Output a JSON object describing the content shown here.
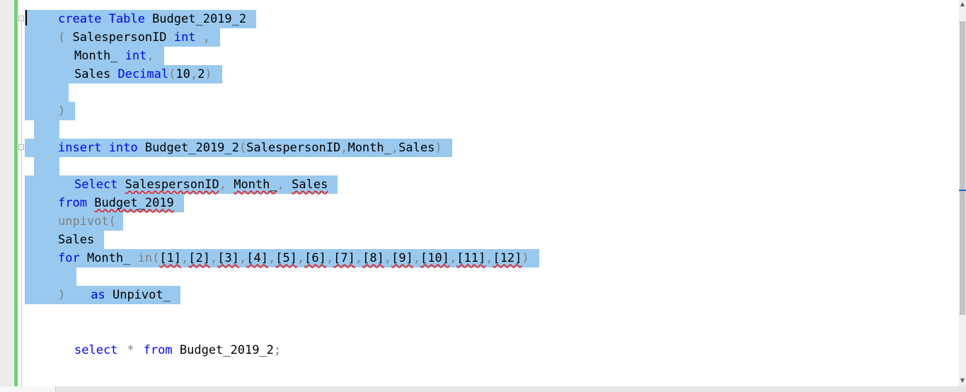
{
  "editor": {
    "lines": {
      "l1": {
        "a": "create Table",
        "b": " Budget_2019_2"
      },
      "l2": {
        "a": "( ",
        "b": "SalespersonID ",
        "c": "int",
        "d": " ,"
      },
      "l3": {
        "a": "Month_ ",
        "b": "int",
        "c": ","
      },
      "l4": {
        "a": "Sales ",
        "b": "Decimal",
        "c": "(",
        "d": "10",
        "e": ",",
        "f": "2",
        "g": ")"
      },
      "l5": {
        "a": ")"
      },
      "l6": {
        "a": "insert into",
        "b": " Budget_2019_2",
        "c": "(",
        "d": "SalespersonID",
        "e": ",",
        "f": "Month_",
        "g": ",",
        "h": "Sales",
        "i": ")"
      },
      "l7": {
        "a": "Select",
        "b": " ",
        "c": "SalespersonID",
        "d": ",",
        "e": " ",
        "f": "Month_",
        "g": ",",
        "h": " ",
        "i": "Sales"
      },
      "l8": {
        "a": "from",
        "b": " ",
        "c": "Budget_2019"
      },
      "l9": {
        "a": "unpivot("
      },
      "l10": {
        "a": "Sales"
      },
      "l11": {
        "a": "for",
        "b": " Month_ ",
        "c": "in(",
        "cols": [
          "[1]",
          "[2]",
          "[3]",
          "[4]",
          "[5]",
          "[6]",
          "[7]",
          "[8]",
          "[9]",
          "[10]",
          "[11]",
          "[12]"
        ],
        "sep": ",",
        "close": ")"
      },
      "l12": {
        "a": ")",
        "b": "as",
        "c": " Unpivot_"
      },
      "l13": {
        "a": "select",
        "b": "*",
        "c": "from",
        "d": " Budget_2019_2",
        "e": ";"
      }
    }
  },
  "outline": {
    "collapse_glyph": "−"
  },
  "scrollbar": {
    "up_arrow": "▲",
    "down_arrow": "▼"
  },
  "colors": {
    "keyword": "#0000ff",
    "operator": "#808080",
    "selection": "#99c9ef",
    "change_bar": "#6fd36f",
    "squiggle": "#e02020"
  }
}
